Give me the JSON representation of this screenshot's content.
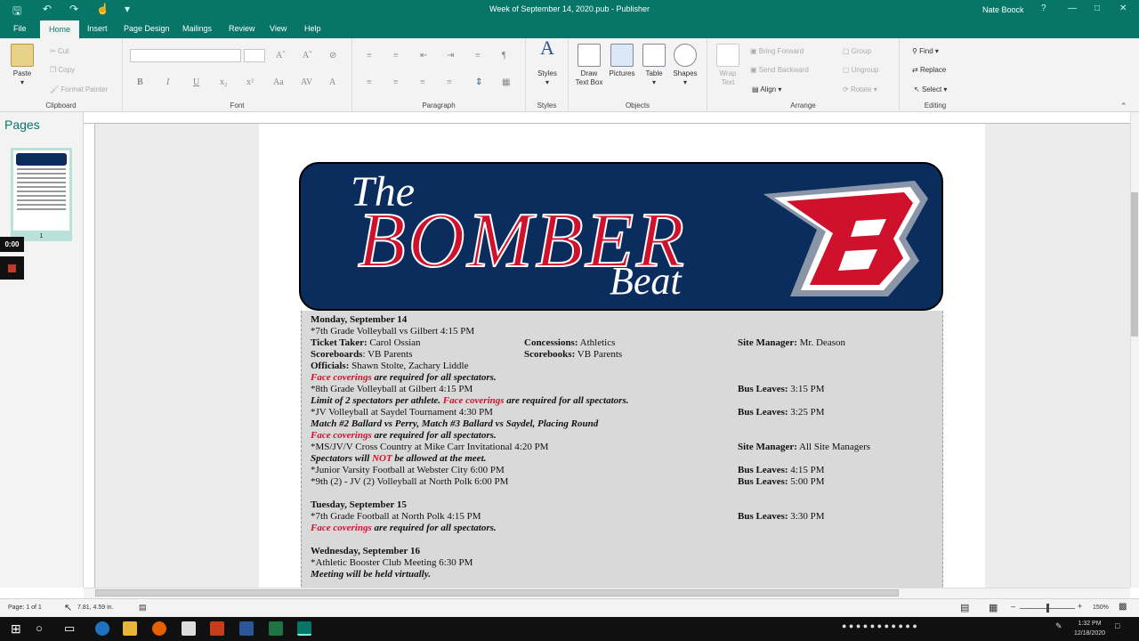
{
  "titlebar": {
    "title": "Week of September 14, 2020.pub  -  Publisher",
    "user": "Nate Boock"
  },
  "tabs": [
    "File",
    "Home",
    "Insert",
    "Page Design",
    "Mailings",
    "Review",
    "View",
    "Help"
  ],
  "ribbon": {
    "clipboard": {
      "paste": "Paste",
      "cut": "Cut",
      "copy": "Copy",
      "format_painter": "Format Painter",
      "label": "Clipboard"
    },
    "font": {
      "label": "Font"
    },
    "paragraph": {
      "label": "Paragraph"
    },
    "styles": {
      "btn": "Styles",
      "label": "Styles"
    },
    "objects": {
      "draw": "Draw Text Box",
      "pictures": "Pictures",
      "table": "Table",
      "shapes": "Shapes",
      "label": "Objects"
    },
    "arrange": {
      "wrap": "Wrap Text",
      "bring": "Bring Forward",
      "send": "Send Backward",
      "align": "Align",
      "group": "Group",
      "ungroup": "Ungroup",
      "rotate": "Rotate",
      "label": "Arrange"
    },
    "editing": {
      "find": "Find",
      "replace": "Replace",
      "select": "Select",
      "label": "Editing"
    }
  },
  "pages_pane": {
    "title": "Pages",
    "page_num": "1"
  },
  "recorder": {
    "time": "0:00"
  },
  "banner": {
    "the": "The",
    "bomber": "BOMBER",
    "beat": "Beat"
  },
  "schedule": {
    "l1": "Monday, September 14",
    "l2": "*7th Grade Volleyball vs Gilbert 4:15 PM",
    "tt_label": "Ticket Taker:",
    "tt_val": " Carol Ossian",
    "conc_label": "Concessions:",
    "conc_val": " Athletics",
    "sm_label": "Site Manager:",
    "sm_val": " Mr. Deason",
    "sb_label": "Scoreboards",
    "sb_val": ": VB Parents",
    "sbk_label": "Scorebooks:",
    "sbk_val": " VB Parents",
    "off_label": "Officials:",
    "off_val": " Shawn Stolte, Zachary Liddle",
    "fc": "Face coverings",
    "fc_rest": " are required for all spectators.",
    "l8": "*8th Grade Volleyball at Gilbert 4:15 PM",
    "bus_label": "Bus Leaves:",
    "bus1": " 3:15 PM",
    "limit": "Limit of 2 spectators per athlete. ",
    "l10": "*JV Volleyball at Saydel Tournament 4:30 PM",
    "bus2": " 3:25 PM",
    "l11": "Match #2 Ballard vs Perry, Match #3 Ballard vs Saydel, Placing Round",
    "l13": "*MS/JV/V Cross Country at Mike Carr Invitational  4:20 PM",
    "sm_all": " All Site Managers",
    "spec1": "Spectators will ",
    "not": "NOT",
    "spec2": " be allowed at the meet.",
    "l15": "*Junior Varsity Football at Webster City 6:00 PM",
    "bus3": " 4:15 PM",
    "l16": "*9th (2) - JV (2) Volleyball at North Polk 6:00 PM",
    "bus4": " 5:00 PM",
    "tue": "Tuesday, September 15",
    "l18": "*7th Grade Football at North Polk 4:15 PM",
    "bus5": " 3:30 PM",
    "wed": "Wednesday, September 16",
    "l21": "*Athletic Booster Club Meeting 6:30 PM",
    "l22": "Meeting will be held virtually."
  },
  "status": {
    "page": "Page: 1 of 1",
    "pos": "7.81, 4.59 in.",
    "zoom": "150%"
  },
  "clock": {
    "time": "1:32 PM",
    "date": "12/18/2020"
  },
  "colors": {
    "accent": "#077568",
    "banner": "#0b2d5e",
    "red": "#d0112b"
  }
}
